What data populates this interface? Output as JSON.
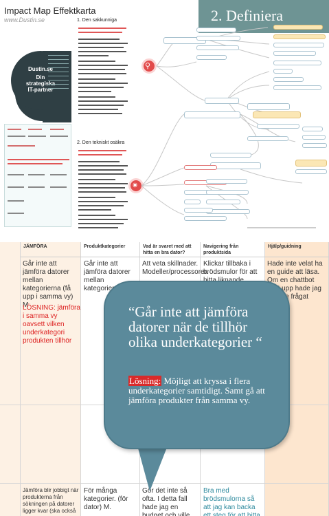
{
  "top": {
    "brand_title": "Impact Map Effektkarta",
    "brand_sub": "www.Dustin.se",
    "stage": "2. Definiera",
    "circle_text": "Dustin.se\nDin strategiska IT-partner\nbästa företag\nbästa för\nsamtliga\nIT-frågor",
    "section1_title": "1. Den sakkunniga",
    "section2_title": "2. Den tekniskt osäkra"
  },
  "sheet": {
    "headers": [
      "JÄMFÖRA",
      "Produktkategorier",
      "Vad är svaret med att hitta en bra dator?",
      "Navigering från produktsida",
      "Hjälp/guidning"
    ],
    "col_a": "Går inte att jämföra datorer mellan kategorierna (få upp i samma vy) M",
    "col_a_solution": "LÖSNING: jämföra i samma vy oavsett vilken underkategori produkten tillhör",
    "col_b": "Går inte att jämföra datorer mellan kategorierna M.",
    "col_c": "Att veta skillnader. Modeller/processorer.",
    "col_d": "Klickar tillbaka i brödsmulor för att hitta liknande produkter (kategori) M.",
    "col_e": "Hade inte velat ha en guide att läsa. Om en chattbot dykt upp hade jag kanske frågat något.",
    "col_b_row3": "För många kategorier. (för dator) M.",
    "col_c_row3": "Gör det inte så ofta. I detta fall hade jag en budget och ville hitta den bästa datorn för",
    "col_d_row3": "Bra med brödsmulorna så att jag kan backa ett steg för att hitta fler produkter i samma",
    "col_a_row3": "Jämföra blir jobbigt när produkterna från sökningen på datorer ligger kvar (ska också"
  },
  "bubble": {
    "quote": "“Går inte att jämföra datorer när de tillhör olika underkategorier “",
    "solution_label": "Lösning:",
    "solution_text": " Möjligt att kryssa i flera underkategorier samtidigt. Samt gå att jämföra produkter från samma vy."
  }
}
